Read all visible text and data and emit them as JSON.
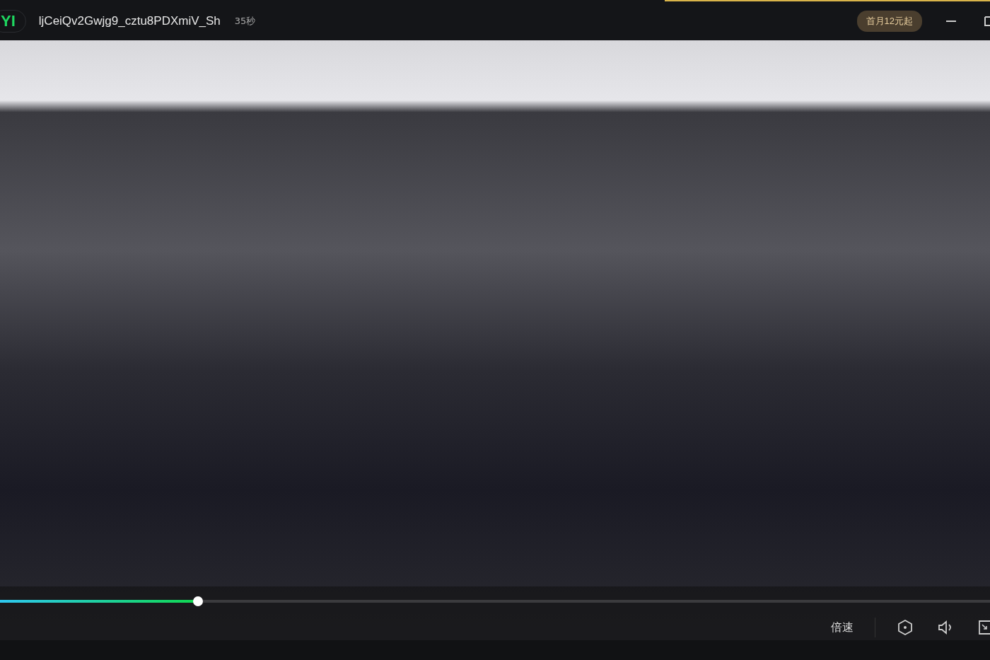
{
  "titlebar": {
    "logo": "YI",
    "title": "ljCeiQv2Gwjg9_cztu8PDXmiV_Sh",
    "duration": "35秒",
    "promo_badge": "首月12元起"
  },
  "controls": {
    "progress": {
      "level": 0.2
    },
    "speed_button": "倍速"
  }
}
